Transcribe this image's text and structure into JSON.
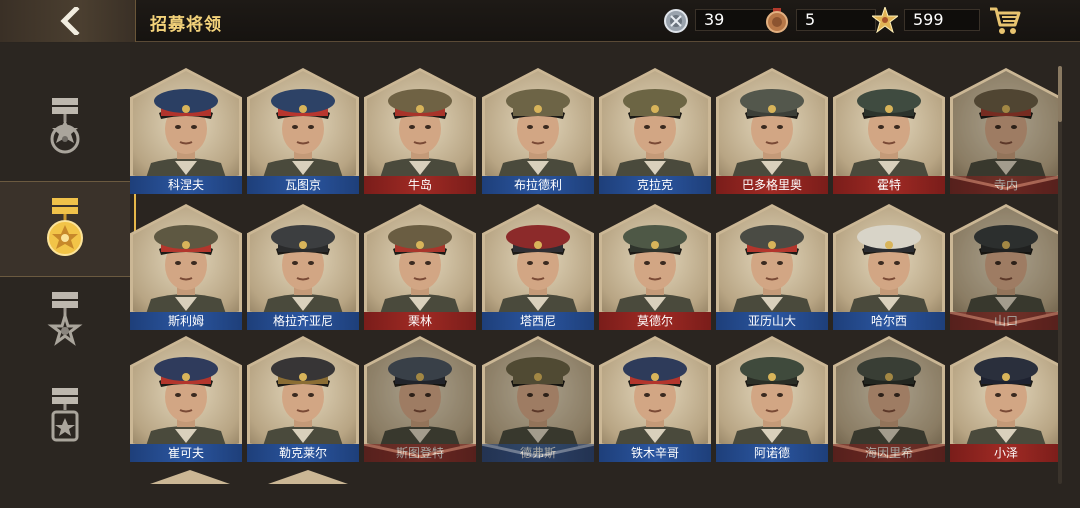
{
  "header": {
    "title": "招募将领",
    "resources": [
      {
        "name": "silver-medal",
        "value": "39"
      },
      {
        "name": "bronze-medal",
        "value": "5"
      },
      {
        "name": "gold-star",
        "value": "599"
      }
    ]
  },
  "sidebar": {
    "tabs": [
      {
        "name": "tier-1",
        "active": false
      },
      {
        "name": "tier-2",
        "active": true
      },
      {
        "name": "tier-3",
        "active": false
      },
      {
        "name": "tier-4",
        "active": false
      }
    ]
  },
  "generals": [
    {
      "name": "科涅夫",
      "faction": "blue",
      "cap": "#2b3f63",
      "band": "#b1342c"
    },
    {
      "name": "瓦图京",
      "faction": "blue",
      "cap": "#2d4266",
      "band": "#b8362e"
    },
    {
      "name": "牛岛",
      "faction": "red",
      "cap": "#6f6244",
      "band": "#a8342a"
    },
    {
      "name": "布拉德利",
      "faction": "blue",
      "cap": "#6d6446",
      "band": "#6d6446"
    },
    {
      "name": "克拉克",
      "faction": "blue",
      "cap": "#6c6544",
      "band": "#6c6544"
    },
    {
      "name": "巴多格里奥",
      "faction": "red",
      "cap": "#53574c",
      "band": "#3c3f38"
    },
    {
      "name": "霍特",
      "faction": "red",
      "cap": "#3f4b40",
      "band": "#2c332c"
    },
    {
      "name": "寺内",
      "faction": "red",
      "dim": true,
      "cap": "#6a5c42",
      "band": "#9e3a2c"
    },
    {
      "name": "斯利姆",
      "faction": "blue",
      "cap": "#5e5842",
      "band": "#b3362c"
    },
    {
      "name": "格拉齐亚尼",
      "faction": "blue",
      "cap": "#3c3e40",
      "band": "#2a2b2c"
    },
    {
      "name": "栗林",
      "faction": "red",
      "cap": "#6a5d42",
      "band": "#a9352b"
    },
    {
      "name": "塔西尼",
      "faction": "blue",
      "cap": "#8c2a2a",
      "band": "#2e2e33"
    },
    {
      "name": "莫德尔",
      "faction": "red",
      "cap": "#4e5846",
      "band": "#2f342c"
    },
    {
      "name": "亚历山大",
      "faction": "blue",
      "cap": "#4a4b44",
      "band": "#b3352c"
    },
    {
      "name": "哈尔西",
      "faction": "blue",
      "cap": "#d8d4c8",
      "band": "#2a2c30"
    },
    {
      "name": "山口",
      "faction": "red",
      "dim": true,
      "cap": "#3b3f3d",
      "band": "#2a2c2b"
    },
    {
      "name": "崔可夫",
      "faction": "blue",
      "cap": "#2f3b5c",
      "band": "#b3352c"
    },
    {
      "name": "勒克莱尔",
      "faction": "blue",
      "cap": "#373536",
      "band": "#8a6d34"
    },
    {
      "name": "斯图登特",
      "faction": "red",
      "dim": true,
      "cap": "#4c5560",
      "band": "#2c3038"
    },
    {
      "name": "德弗斯",
      "faction": "blue",
      "dim": true,
      "cap": "#6a6244",
      "band": "#6a6244"
    },
    {
      "name": "铁木辛哥",
      "faction": "blue",
      "cap": "#2e3b5a",
      "band": "#b3352c"
    },
    {
      "name": "阿诺德",
      "faction": "blue",
      "cap": "#3f4a3c",
      "band": "#2a2e26"
    },
    {
      "name": "海因里希",
      "faction": "red",
      "dim": true,
      "cap": "#4c5346",
      "band": "#2e322b"
    },
    {
      "name": "小泽",
      "faction": "red",
      "cap": "#2a2f3c",
      "band": "#1e2230"
    }
  ]
}
